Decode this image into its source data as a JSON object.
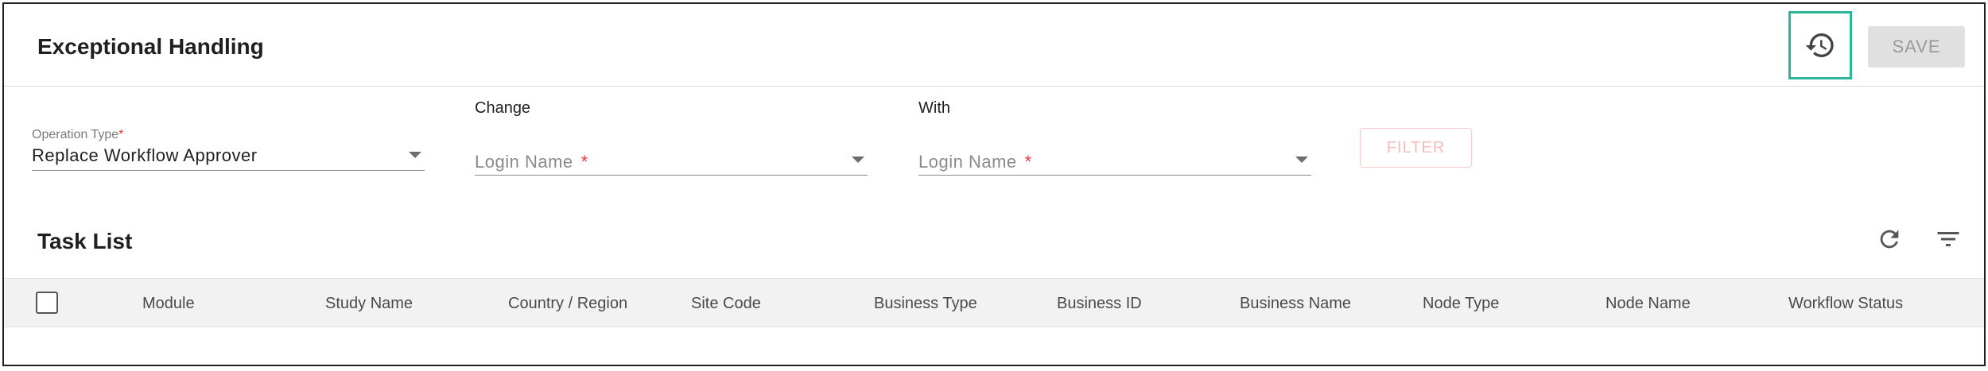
{
  "header": {
    "title": "Exceptional Handling",
    "history_icon": "history-icon",
    "save_label": "SAVE"
  },
  "filters": {
    "operation_type": {
      "label": "Operation Type",
      "required_mark": "*",
      "value": "Replace Workflow Approver"
    },
    "change": {
      "caption": "Change",
      "placeholder": "Login Name",
      "required_mark": "*"
    },
    "with": {
      "caption": "With",
      "placeholder": "Login Name",
      "required_mark": "*"
    },
    "filter_label": "FILTER"
  },
  "task_list": {
    "title": "Task List",
    "refresh_icon": "refresh-icon",
    "filter_icon": "filter-list-icon",
    "columns": [
      "Module",
      "Study Name",
      "Country / Region",
      "Site Code",
      "Business Type",
      "Business ID",
      "Business Name",
      "Node Type",
      "Node Name",
      "Workflow Status"
    ]
  },
  "colors": {
    "accent_highlight": "#2bb59a",
    "required": "#e53935",
    "disabled_button": "#e0e0e0",
    "filter_button_disabled": "#f5bcbc"
  }
}
